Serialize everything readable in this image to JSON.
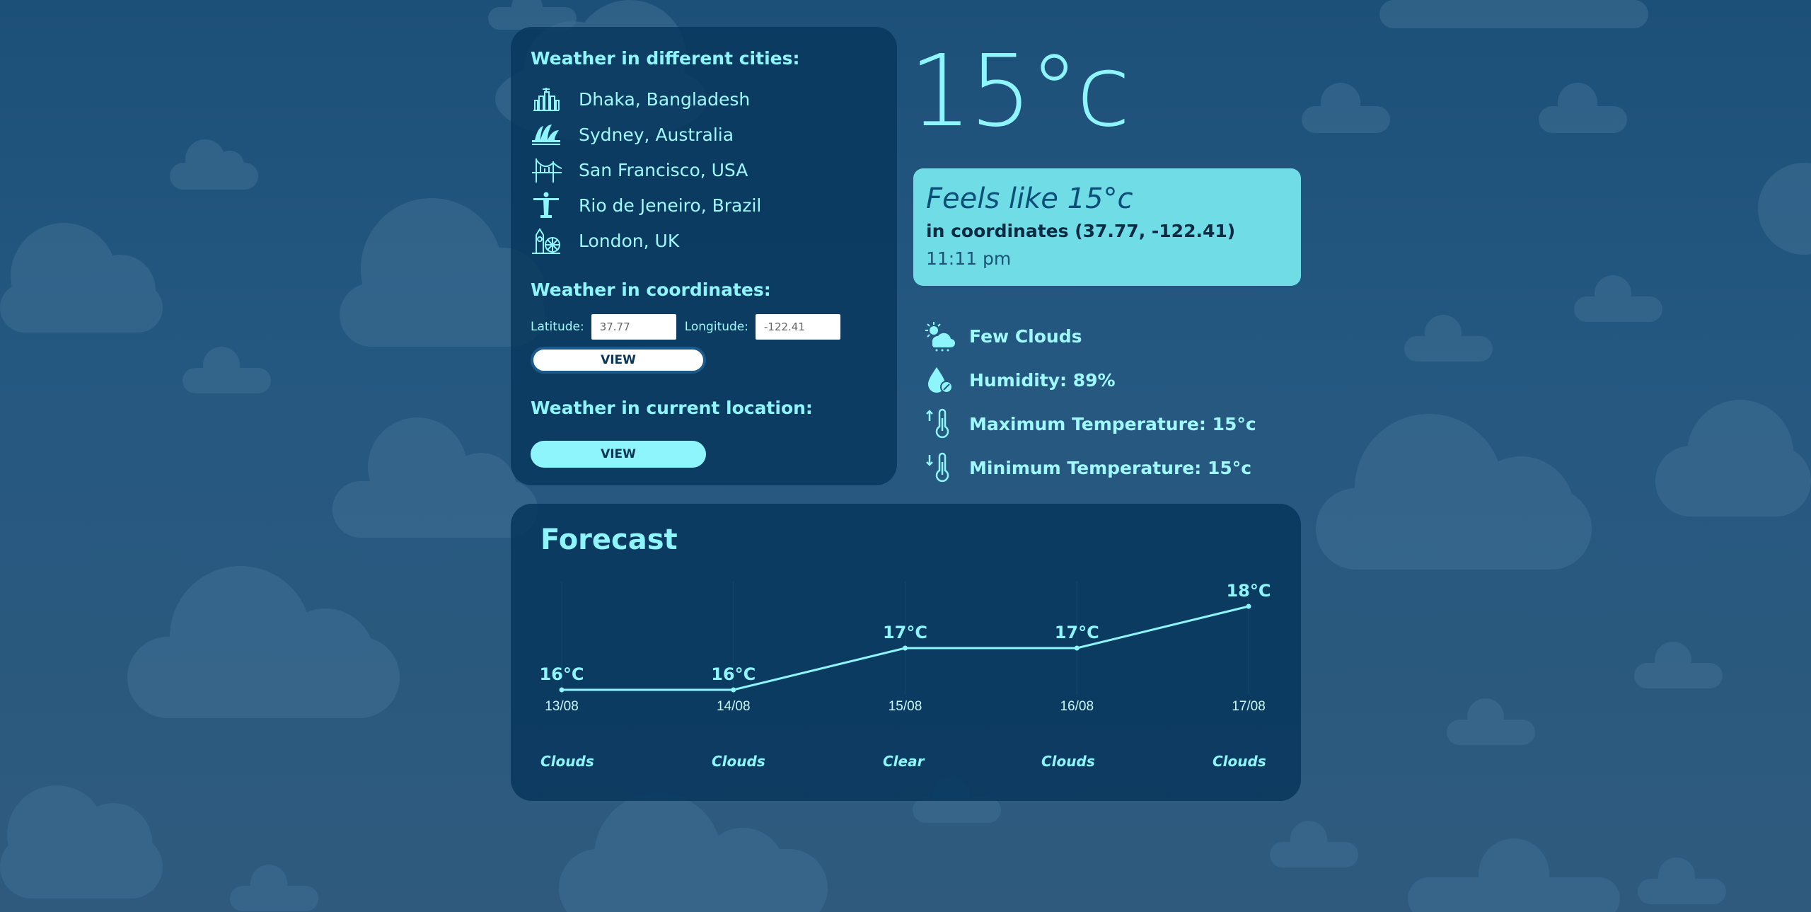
{
  "cities": {
    "title": "Weather in different cities:",
    "items": [
      {
        "label": "Dhaka, Bangladesh",
        "icon": "dhaka-landmark-icon"
      },
      {
        "label": "Sydney, Australia",
        "icon": "sydney-opera-icon"
      },
      {
        "label": "San Francisco, USA",
        "icon": "golden-gate-icon"
      },
      {
        "label": "Rio de Jeneiro, Brazil",
        "icon": "christ-redeemer-icon"
      },
      {
        "label": "London, UK",
        "icon": "big-ben-icon"
      }
    ]
  },
  "coordinates": {
    "title": "Weather in coordinates:",
    "latitude_label": "Latitude:",
    "latitude_value": "37.77",
    "longitude_label": "Longitude:",
    "longitude_value": "-122.41",
    "button": "VIEW"
  },
  "current_location": {
    "title": "Weather in current location:",
    "button": "VIEW"
  },
  "current": {
    "temperature": "15°c",
    "feels_like": "Feels like 15°c",
    "coordinates_text": "in coordinates (37.77, -122.41)",
    "time": "11:11 pm",
    "details": [
      {
        "label": "Few Clouds",
        "icon": "few-clouds-icon"
      },
      {
        "label": "Humidity: 89%",
        "icon": "humidity-icon"
      },
      {
        "label": "Maximum Temperature: 15°c",
        "icon": "max-temp-icon"
      },
      {
        "label": "Minimum Temperature: 15°c",
        "icon": "min-temp-icon"
      }
    ]
  },
  "forecast": {
    "title": "Forecast",
    "days": [
      {
        "date": "13/08",
        "temp": "16°C",
        "weather": "Clouds"
      },
      {
        "date": "14/08",
        "temp": "16°C",
        "weather": "Clouds"
      },
      {
        "date": "15/08",
        "temp": "17°C",
        "weather": "Clear"
      },
      {
        "date": "16/08",
        "temp": "17°C",
        "weather": "Clouds"
      },
      {
        "date": "17/08",
        "temp": "18°C",
        "weather": "Clouds"
      }
    ]
  },
  "chart_data": {
    "type": "line",
    "categories": [
      "13/08",
      "14/08",
      "15/08",
      "16/08",
      "17/08"
    ],
    "values": [
      16,
      16,
      17,
      17,
      18
    ],
    "title": "Forecast",
    "xlabel": "",
    "ylabel": ""
  }
}
